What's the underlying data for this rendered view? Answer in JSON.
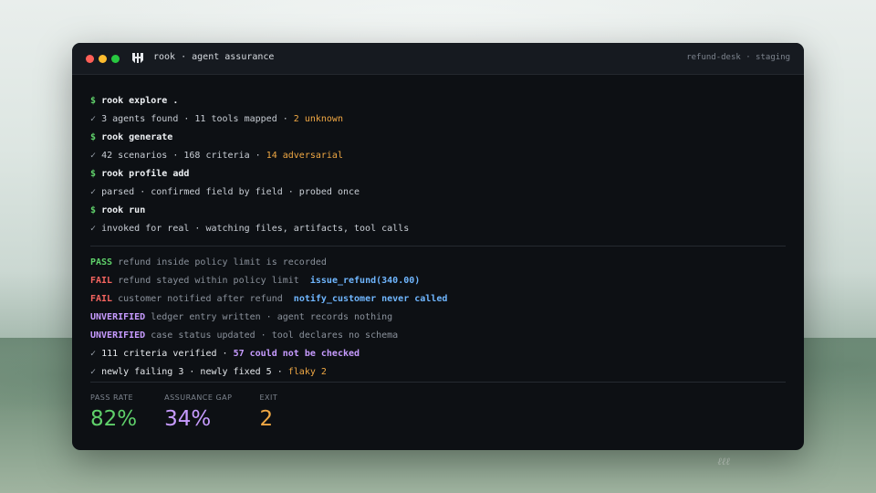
{
  "window": {
    "app_title": "rook · agent assurance",
    "env": "refund-desk · staging"
  },
  "terminal": {
    "steps": [
      {
        "prompt": "$",
        "command": "rook explore .",
        "check": "✓",
        "result": "3 agents found · 11 tools mapped · ",
        "highlight": "2 unknown"
      },
      {
        "prompt": "$",
        "command": "rook generate",
        "check": "✓",
        "result": "42 scenarios · 168 criteria · ",
        "highlight": "14 adversarial"
      },
      {
        "prompt": "$",
        "command": "rook profile add",
        "check": "✓",
        "result": "parsed · confirmed field by field · probed once",
        "highlight": ""
      },
      {
        "prompt": "$",
        "command": "rook run",
        "check": "✓",
        "result": "invoked for real · watching files, artifacts, tool calls",
        "highlight": ""
      }
    ],
    "results": [
      {
        "status": "PASS",
        "text": "refund inside policy limit is recorded",
        "detail": ""
      },
      {
        "status": "FAIL",
        "text": "refund stayed within policy limit",
        "detail": "issue_refund(340.00)"
      },
      {
        "status": "FAIL",
        "text": "customer notified after refund",
        "detail": "notify_customer never called"
      },
      {
        "status": "UNVERIFIED",
        "text": "ledger entry written · agent records nothing",
        "detail": ""
      },
      {
        "status": "UNVERIFIED",
        "text": "case status updated · tool declares no schema",
        "detail": ""
      }
    ],
    "summary1": {
      "check": "✓",
      "text": "111 criteria verified · ",
      "highlight": "57 could not be checked"
    },
    "summary2": {
      "check": "✓",
      "text": "newly failing 3 · newly fixed 5 · ",
      "highlight": "flaky 2"
    }
  },
  "stats": {
    "pass_rate_label": "PASS RATE",
    "pass_rate_value": "82%",
    "gap_label": "ASSURANCE GAP",
    "gap_value": "34%",
    "exit_label": "EXIT",
    "exit_value": "2"
  },
  "colors": {
    "pass": "#5fd06a",
    "fail": "#f4645f",
    "unverified": "#c79bff",
    "highlight": "#f0a844",
    "tool": "#6fb6ff"
  }
}
